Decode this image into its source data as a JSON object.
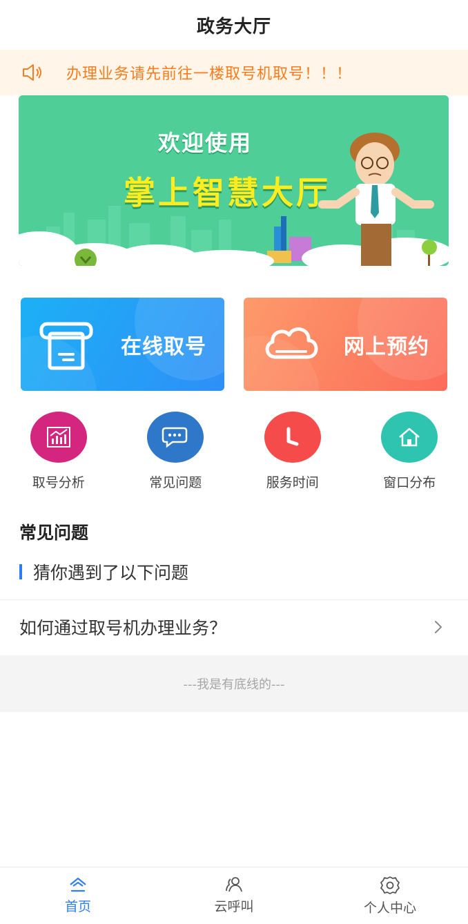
{
  "header": {
    "title": "政务大厅"
  },
  "notice": {
    "text": "办理业务请先前往一楼取号机取号！！！",
    "icon": "speaker-icon",
    "color": "#ff7a1a"
  },
  "banner": {
    "line1": "欢迎使用",
    "line2": "掌上智慧大厅",
    "slides": 2,
    "active_slide": 1
  },
  "big_actions": [
    {
      "label": "在线取号",
      "icon": "ticket-machine-icon",
      "color": "#1cb0f6"
    },
    {
      "label": "网上预约",
      "icon": "cloud-icon",
      "color": "#fc7a5f"
    }
  ],
  "shortcuts": [
    {
      "label": "取号分析",
      "icon": "chart-icon",
      "color": "#d5267f"
    },
    {
      "label": "常见问题",
      "icon": "chat-icon",
      "color": "#2f78c9"
    },
    {
      "label": "服务时间",
      "icon": "clock-icon",
      "color": "#f54b4b"
    },
    {
      "label": "窗口分布",
      "icon": "home-icon",
      "color": "#2ec4b0"
    }
  ],
  "faq": {
    "title": "常见问题",
    "subtitle": "猜你遇到了以下问题",
    "items": [
      {
        "question": "如何通过取号机办理业务？"
      }
    ]
  },
  "footer_line": "---我是有底线的---",
  "tabbar": {
    "items": [
      {
        "label": "首页",
        "icon": "home-outline-icon",
        "active": true
      },
      {
        "label": "云呼叫",
        "icon": "people-icon",
        "active": false
      },
      {
        "label": "个人中心",
        "icon": "gear-icon",
        "active": false
      }
    ],
    "active_color": "#2f7ef5"
  }
}
